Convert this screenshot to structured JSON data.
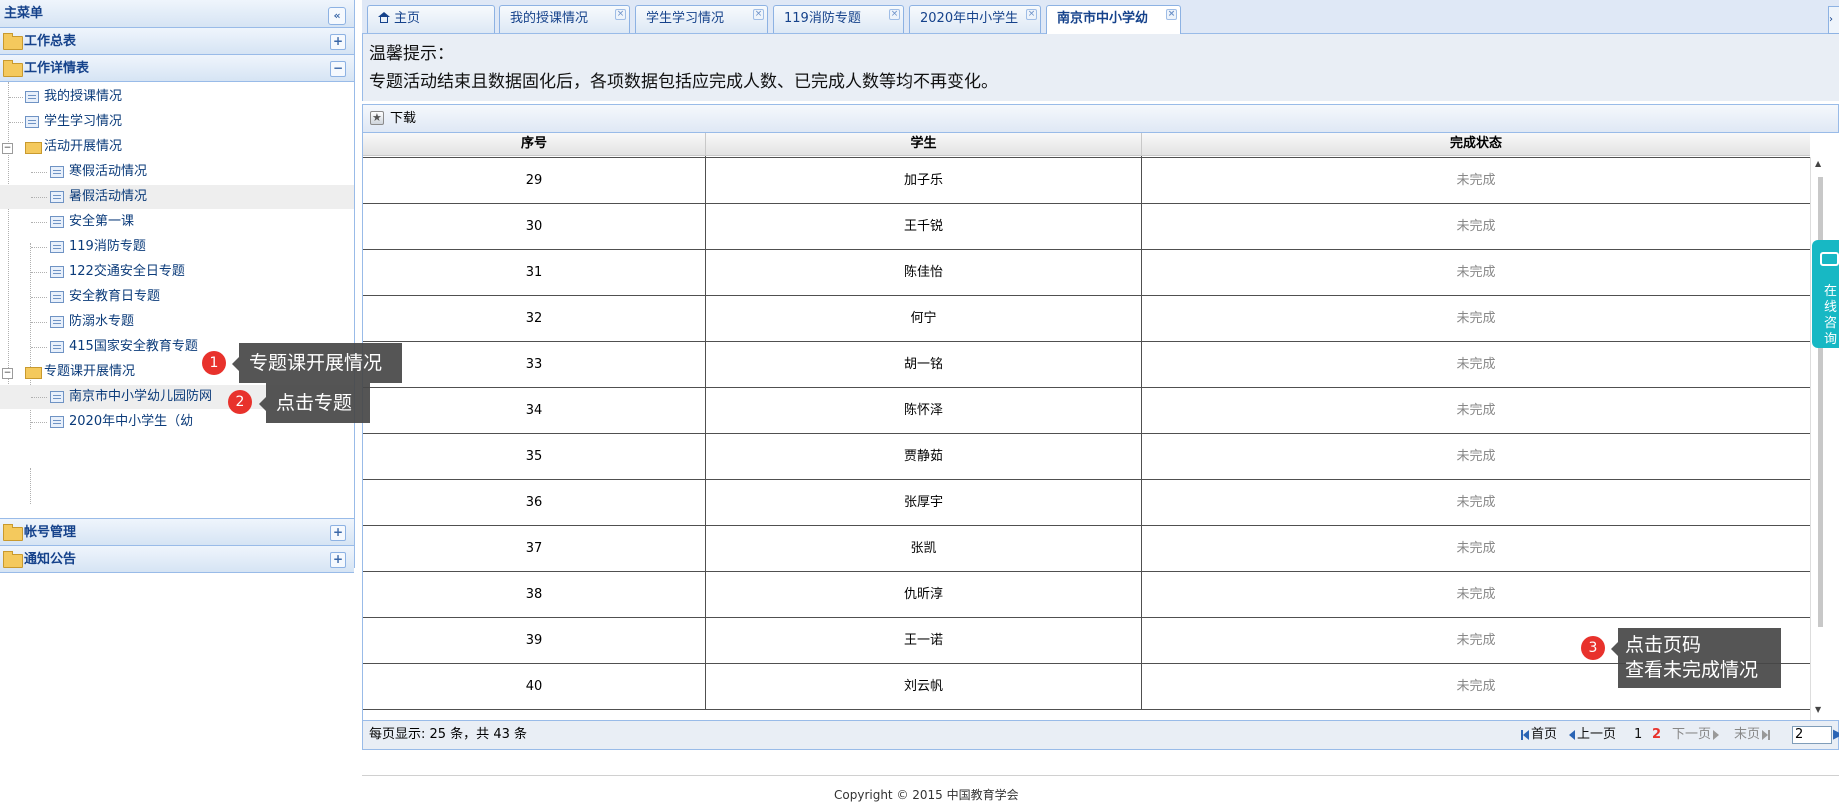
{
  "sidebar": {
    "title": "主菜单",
    "collapse_icon": "«",
    "sections": {
      "work_summary": {
        "label": "工作总表",
        "toggle": "+"
      },
      "work_detail": {
        "label": "工作详情表",
        "toggle": "−"
      },
      "account": {
        "label": "帐号管理",
        "toggle": "+"
      },
      "notice": {
        "label": "通知公告",
        "toggle": "+"
      }
    },
    "tree": [
      {
        "label": "我的授课情况"
      },
      {
        "label": "学生学习情况"
      },
      {
        "label": "活动开展情况",
        "expander": "−"
      },
      {
        "label": "寒假活动情况"
      },
      {
        "label": "暑假活动情况"
      },
      {
        "label": "安全第一课"
      },
      {
        "label": "119消防专题"
      },
      {
        "label": "122交通安全日专题"
      },
      {
        "label": "安全教育日专题"
      },
      {
        "label": "防溺水专题"
      },
      {
        "label": "415国家安全教育专题"
      },
      {
        "label": "专题课开展情况",
        "expander": "−"
      },
      {
        "label": "南京市中小学幼儿园防网"
      },
      {
        "label": "2020年中小学生（幼"
      }
    ]
  },
  "tooltips": [
    {
      "number": "1",
      "text": "专题课开展情况"
    },
    {
      "number": "2",
      "text": "点击专题"
    },
    {
      "number": "3",
      "line1": "点击页码",
      "line2": "查看未完成情况"
    }
  ],
  "tabs": [
    {
      "label": "主页",
      "closable": false
    },
    {
      "label": "我的授课情况",
      "close": "×"
    },
    {
      "label": "学生学习情况",
      "close": "×"
    },
    {
      "label": "119消防专题",
      "close": "×"
    },
    {
      "label": "2020年中小学生",
      "close": "×"
    },
    {
      "label": "南京市中小学幼",
      "close": "×"
    }
  ],
  "notice": {
    "title": "温馨提示：",
    "text": "专题活动结束且数据固化后，各项数据包括应完成人数、已完成人数等均不再变化。"
  },
  "toolbar": {
    "download_label": "下载"
  },
  "grid": {
    "headers": [
      "序号",
      "学生",
      "完成状态"
    ],
    "rows": [
      {
        "no": "29",
        "name": "加子乐",
        "status": "未完成"
      },
      {
        "no": "30",
        "name": "王千锐",
        "status": "未完成"
      },
      {
        "no": "31",
        "name": "陈佳怡",
        "status": "未完成"
      },
      {
        "no": "32",
        "name": "何宁",
        "status": "未完成"
      },
      {
        "no": "33",
        "name": "胡一铭",
        "status": "未完成"
      },
      {
        "no": "34",
        "name": "陈怀泽",
        "status": "未完成"
      },
      {
        "no": "35",
        "name": "贾静茹",
        "status": "未完成"
      },
      {
        "no": "36",
        "name": "张厚宇",
        "status": "未完成"
      },
      {
        "no": "37",
        "name": "张凯",
        "status": "未完成"
      },
      {
        "no": "38",
        "name": "仇昕淳",
        "status": "未完成"
      },
      {
        "no": "39",
        "name": "王一诺",
        "status": "未完成"
      },
      {
        "no": "40",
        "name": "刘云帆",
        "status": "未完成"
      }
    ]
  },
  "pager": {
    "info": "每页显示: 25 条，共 43 条",
    "first": "首页",
    "prev": "上一页",
    "page1": "1",
    "page2": "2",
    "next": "下一页",
    "last": "末页",
    "input_value": "2"
  },
  "float_chat": {
    "text": "在线咨询"
  },
  "footer": {
    "copyright": "Copyright © 2015 中国教育学会"
  },
  "colors": {
    "accent": "#15428b",
    "badge": "#e8322c",
    "chat": "#17b8c4"
  }
}
